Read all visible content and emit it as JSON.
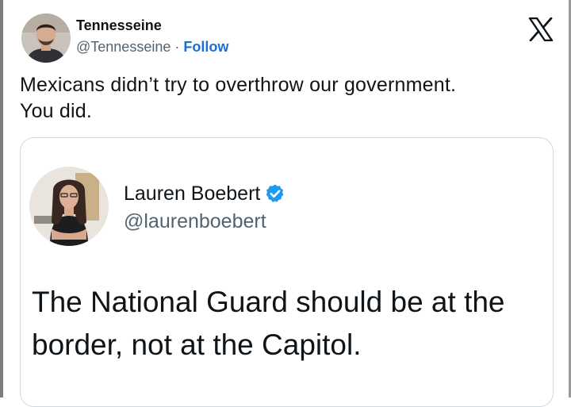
{
  "tweet": {
    "author_name": "Tennesseine",
    "author_handle": "@Tennesseine",
    "separator": "·",
    "follow_label": "Follow",
    "logo_icon": "x-logo-icon",
    "text_line1": "Mexicans didn’t try to overthrow our government.",
    "text_line2": "You did."
  },
  "quoted_tweet": {
    "author_name": "Lauren Boebert",
    "verified_icon": "verified-badge-icon",
    "author_handle": "@laurenboebert",
    "text_line1": "The National Guard should be at the",
    "text_line2": "border, not at the Capitol."
  },
  "colors": {
    "follow": "#1d6fd1",
    "verified": "#1d9bf0",
    "secondary_text": "#536471"
  }
}
